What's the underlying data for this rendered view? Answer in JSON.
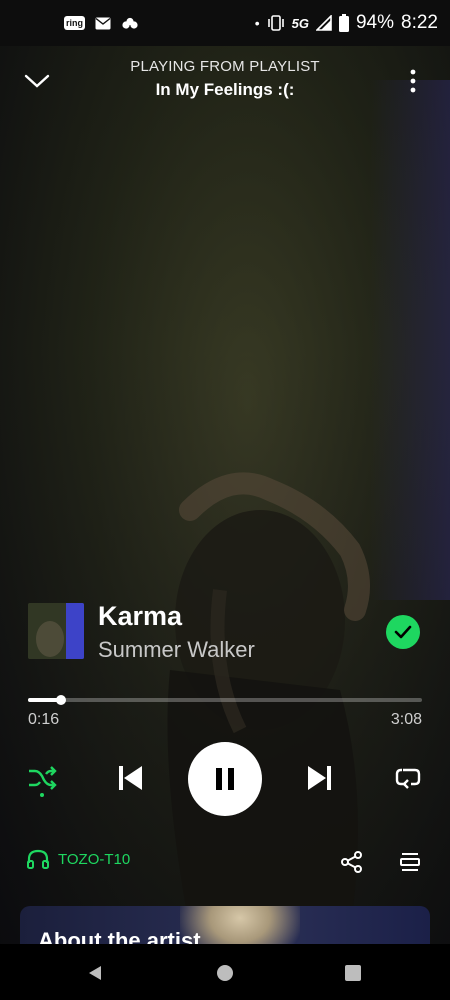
{
  "status_bar": {
    "notification_icons": [
      "ring-icon",
      "mail-icon",
      "cloud-icon"
    ],
    "ring_label": "ring",
    "network_label": "5G",
    "battery": "94%",
    "time": "8:22"
  },
  "header": {
    "playing_from": "PLAYING FROM PLAYLIST",
    "playlist_name": "In My Feelings :(:"
  },
  "track": {
    "title": "Karma",
    "artist": "Summer Walker",
    "liked": true
  },
  "progress": {
    "elapsed": "0:16",
    "total": "3:08",
    "fraction": 0.085
  },
  "controls": {
    "shuffle_active": true,
    "is_playing": true
  },
  "device": {
    "name": "TOZO-T10"
  },
  "about": {
    "title": "About the artist"
  },
  "colors": {
    "accent": "#1ed760",
    "background": "#1f231a"
  }
}
